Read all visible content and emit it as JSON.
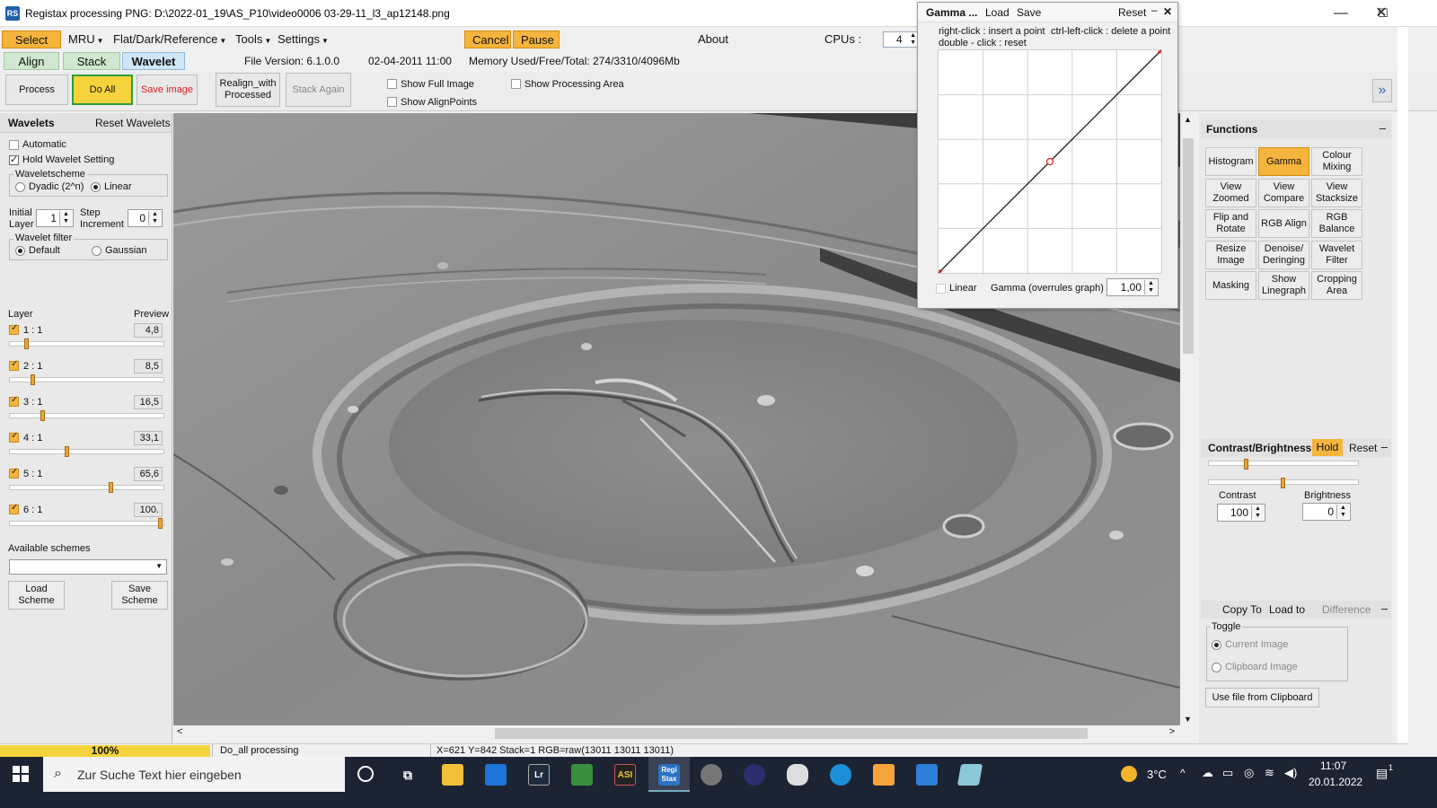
{
  "window": {
    "icon_text": "RS",
    "title": "Registax processing PNG: D:\\2022-01_19\\AS_P10\\video0006 03-29-11_l3_ap12148.png",
    "min_glyph": "—",
    "max_glyph": "☐",
    "close_glyph": "✕"
  },
  "menu": {
    "select": "Select",
    "mru": "MRU",
    "flat": "Flat/Dark/Reference",
    "tools": "Tools",
    "settings": "Settings",
    "cancel": "Cancel",
    "pause": "Pause",
    "about": "About",
    "cpus_label": "CPUs :",
    "cpus_value": "4"
  },
  "tabs": {
    "align": "Align",
    "stack": "Stack",
    "wavelet": "Wavelet"
  },
  "info": {
    "file_version": "File Version: 6.1.0.0",
    "date": "02-04-2011 11:00",
    "memory": "Memory Used/Free/Total: 274/3310/4096Mb"
  },
  "toolbar": {
    "process": "Process",
    "do_all": "Do All",
    "save_image": "Save image",
    "realign": "Realign_with Processed",
    "stack_again": "Stack Again",
    "show_full_image": "Show Full Image",
    "show_alignpoints": "Show AlignPoints",
    "show_processing_area": "Show Processing Area",
    "expand_glyph": "»"
  },
  "wavelets": {
    "header": "Wavelets",
    "reset": "Reset Wavelets",
    "automatic": "Automatic",
    "hold": "Hold Wavelet Setting",
    "scheme_title": "Waveletscheme",
    "dyadic": "Dyadic (2^n)",
    "linear": "Linear",
    "initial_layer_label": "Initial Layer",
    "initial_layer_value": "1",
    "step_increment_label": "Step Increment",
    "step_increment_value": "0",
    "filter_title": "Wavelet filter",
    "default": "Default",
    "gaussian": "Gaussian",
    "layer_header": "Layer",
    "preview_header": "Preview",
    "layers": [
      {
        "label": "1 : 1",
        "value": "4,8",
        "slider": 0.1
      },
      {
        "label": "2 : 1",
        "value": "8,5",
        "slider": 0.14
      },
      {
        "label": "3 : 1",
        "value": "16,5",
        "slider": 0.21
      },
      {
        "label": "4 : 1",
        "value": "33,1",
        "slider": 0.37
      },
      {
        "label": "5 : 1",
        "value": "65,6",
        "slider": 0.66
      },
      {
        "label": "6 : 1",
        "value": "100.",
        "slider": 0.99
      }
    ],
    "available_schemes": "Available schemes",
    "load_scheme": "Load Scheme",
    "save_scheme": "Save Scheme"
  },
  "gamma": {
    "title": "Gamma ...",
    "load": "Load",
    "save": "Save",
    "reset": "Reset",
    "hint1": "right-click : insert a point",
    "hint2": "ctrl-left-click : delete a point",
    "hint3": "double - click : reset",
    "linear": "Linear",
    "gamma_label": "Gamma (overrules graph)",
    "gamma_value": "1,00"
  },
  "functions": {
    "header": "Functions",
    "buttons": [
      "Histogram",
      "Gamma",
      "Colour Mixing",
      "View Zoomed",
      "View Compare",
      "View Stacksize",
      "Flip and Rotate",
      "RGB Align",
      "RGB Balance",
      "Resize Image",
      "Denoise/ Deringing",
      "Wavelet Filter",
      "Masking",
      "Show Linegraph",
      "Cropping Area"
    ]
  },
  "contrast": {
    "header": "Contrast/Brightness",
    "hold": "Hold",
    "reset": "Reset",
    "contrast_label": "Contrast",
    "contrast_value": "100",
    "brightness_label": "Brightness",
    "brightness_value": "0"
  },
  "copyto": {
    "copy_to": "Copy To",
    "load_to": "Load to",
    "difference": "Difference",
    "toggle": "Toggle",
    "current_image": "Current Image",
    "clipboard_image": "Clipboard Image",
    "use_clipboard": "Use file from Clipboard"
  },
  "status": {
    "progress": "100%",
    "progress_value": 1.0,
    "task": "Do_all processing",
    "coords": "X=621 Y=842 Stack=1 RGB=raw(13011 13011 13011)"
  },
  "taskbar": {
    "search_placeholder": "Zur Suche Text hier eingeben",
    "weather": "3°C",
    "time": "11:07",
    "date": "20.01.2022",
    "notification_count": "1",
    "apps": [
      "Lr",
      "ASI",
      "Regi Stax"
    ]
  }
}
